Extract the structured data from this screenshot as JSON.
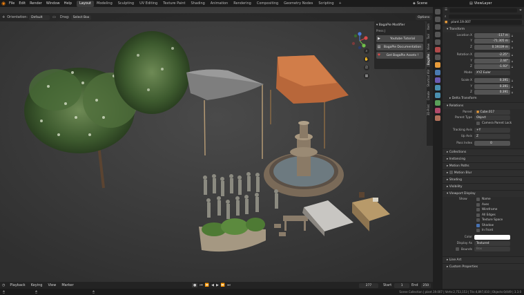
{
  "menu": [
    "File",
    "Edit",
    "Render",
    "Window",
    "Help"
  ],
  "workspaces": [
    "Layout",
    "Modeling",
    "Sculpting",
    "UV Editing",
    "Texture Paint",
    "Shading",
    "Animation",
    "Rendering",
    "Compositing",
    "Geometry Nodes",
    "Scripting"
  ],
  "workspace_add": "+",
  "scene": {
    "icon": "scene-icon",
    "name": "Scene"
  },
  "view_layer": "ViewLayer",
  "header": {
    "mode": "Object Mode",
    "view_menus": [
      "View",
      "Select",
      "Add",
      "Object"
    ],
    "transform_orientation": "Normal",
    "orientation_label": "Orientation:",
    "orientation_value": "Default",
    "drag_label": "Drag:",
    "drag_value": "Select Box",
    "options": "Options"
  },
  "npanel": {
    "title": "BagaPie Modifier",
    "subtitle": "Press J",
    "buttons": [
      {
        "icon": "play-icon",
        "label": "Youtube Tutorial"
      },
      {
        "icon": "document-icon",
        "label": "BagaPie Documentation"
      },
      {
        "icon": "heart-icon",
        "label": "Get BagaPie Assets !"
      }
    ],
    "tabs": [
      "Item",
      "Tool",
      "View",
      "BagaPie",
      "Shortcut VUr",
      "Create",
      "3D-Print"
    ],
    "active_tab": "BagaPie"
  },
  "timeline": {
    "menus": [
      "Playback",
      "Keying",
      "View",
      "Marker"
    ],
    "current_frame": "277",
    "start_label": "Start",
    "start": "1",
    "end_label": "End",
    "end": "250"
  },
  "status": "Scene Collection | plant.19.007 | Verts:2,753,153 | Tris:4,897,810 | Objects:0/449 | 3.3.0",
  "properties": {
    "search_placeholder": "",
    "object_name": "plant.19.007",
    "transform_title": "Transform",
    "location_label": "Location X",
    "location": [
      "-117 m",
      "-71.305 m",
      "0.19339 m"
    ],
    "rotation_label": "Rotation X",
    "rotation": [
      "-2.25°",
      "2.44°",
      "-1.93°"
    ],
    "mode_label": "Mode",
    "mode_value": "XYZ Euler",
    "scale_label": "Scale X",
    "scale": [
      "0.391",
      "0.391",
      "0.391"
    ],
    "axis_y": "Y",
    "axis_z": "Z",
    "delta_title": "Delta Transform",
    "relations_title": "Relations",
    "parent_label": "Parent",
    "parent_value": "Cube.017",
    "parent_type_label": "Parent Type",
    "parent_type_value": "Object",
    "camera_parent_lock": "Camera Parent Lock",
    "tracking_axis_label": "Tracking Axis",
    "tracking_axis_value": "+Y",
    "up_axis_label": "Up Axis",
    "up_axis_value": "Z",
    "pass_index_label": "Pass Index",
    "pass_index_value": "0",
    "sections": [
      "Collections",
      "Instancing",
      "Motion Paths",
      "Motion Blur",
      "Shading",
      "Visibility"
    ],
    "viewport_display_title": "Viewport Display",
    "show_label": "Show",
    "show_items": [
      {
        "label": "Name",
        "on": false
      },
      {
        "label": "Axes",
        "on": false
      },
      {
        "label": "Wireframe",
        "on": false
      },
      {
        "label": "All Edges",
        "on": false
      },
      {
        "label": "Texture Space",
        "on": false
      },
      {
        "label": "Shadow",
        "on": true
      },
      {
        "label": "In Front",
        "on": false
      }
    ],
    "color_label": "Color",
    "display_as_label": "Display As",
    "display_as_value": "Textured",
    "bounds_label": "Bounds",
    "bounds_value": "Box",
    "bottom_sections": [
      "Line Art",
      "Custom Properties"
    ]
  },
  "colors": {
    "accent": "#4772b3",
    "active_tab": "#3c3c3c",
    "viewport": "#3a3a3a"
  }
}
